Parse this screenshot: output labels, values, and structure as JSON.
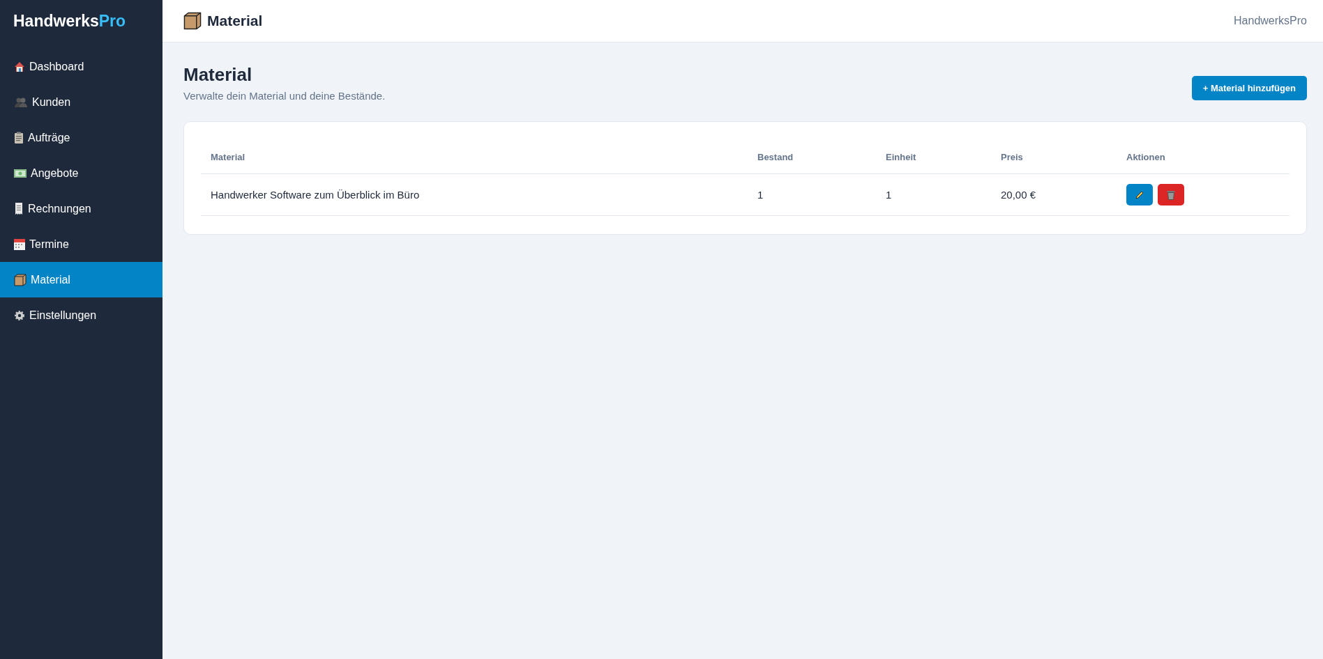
{
  "logo": {
    "text": "Handwerks",
    "accent": "Pro"
  },
  "sidebar": {
    "items": [
      {
        "label": "Dashboard",
        "selected": false
      },
      {
        "label": "Kunden",
        "selected": false
      },
      {
        "label": "Aufträge",
        "selected": false
      },
      {
        "label": "Angebote",
        "selected": false
      },
      {
        "label": "Rechnungen",
        "selected": false
      },
      {
        "label": "Termine",
        "selected": false
      },
      {
        "label": "Material",
        "selected": true
      },
      {
        "label": "Einstellungen",
        "selected": false
      }
    ]
  },
  "header": {
    "title": "Material",
    "user": "HandwerksPro"
  },
  "page": {
    "title": "Material",
    "subtitle": "Verwalte dein Material und deine Bestände.",
    "add_button": "+ Material hinzufügen"
  },
  "table": {
    "columns": [
      "Material",
      "Bestand",
      "Einheit",
      "Preis",
      "Aktionen"
    ],
    "rows": [
      {
        "cells": [
          "Handwerker Software zum Überblick im Büro",
          "1",
          "1",
          "20,00 €"
        ]
      }
    ]
  }
}
